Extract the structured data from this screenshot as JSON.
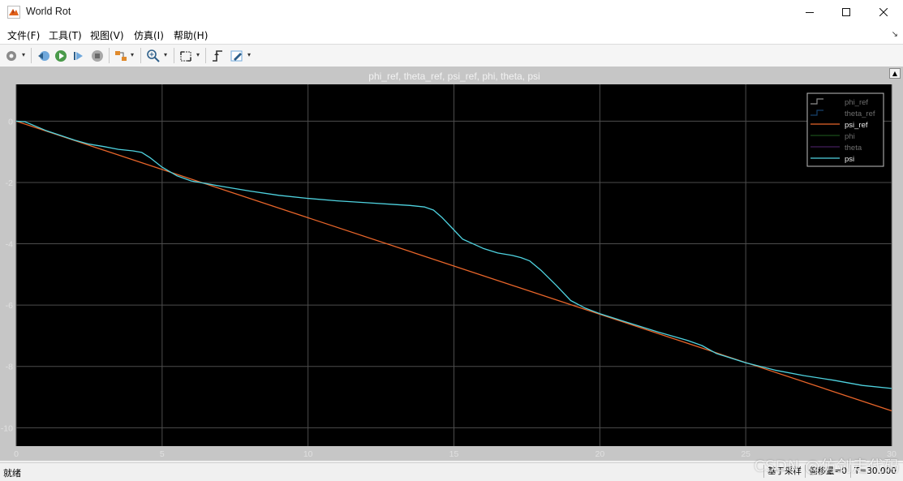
{
  "window": {
    "title": "World Rot",
    "icon": "matlab-logo-icon",
    "controls": [
      "minimize-icon",
      "maximize-icon",
      "close-icon"
    ]
  },
  "menu": {
    "items": [
      {
        "label": "文件(F)"
      },
      {
        "label": "工具(T)"
      },
      {
        "label": "视图(V)"
      },
      {
        "label": "仿真(I)"
      },
      {
        "label": "帮助(H)"
      }
    ]
  },
  "toolbar": {
    "buttons": [
      "settings-gear-icon",
      "step-back-icon",
      "run-icon",
      "step-forward-icon",
      "stop-icon",
      "highlight-simulink-block-icon",
      "zoom-in-icon",
      "fit-axes-icon",
      "trigger-icon",
      "style-pen-icon"
    ]
  },
  "colors": {
    "plot_bg": "#000000",
    "frame_bg": "#c6c6c6",
    "grid": "#4d4d4d",
    "axis_text": "#e0e0e0",
    "psi_ref": "#e8652a",
    "psi": "#4fd3e0",
    "phi_ref": "#ffffff",
    "theta_ref": "#2979c8",
    "phi": "#2e8b2e",
    "theta": "#7a3aa8"
  },
  "chart_data": {
    "type": "line",
    "title": "phi_ref, theta_ref, psi_ref, phi, theta, psi",
    "xlabel": "",
    "ylabel": "",
    "xlim": [
      0,
      30
    ],
    "ylim": [
      -10.6,
      1.2
    ],
    "xticks": [
      0,
      5,
      10,
      15,
      20,
      25,
      30
    ],
    "yticks": [
      0,
      -2,
      -4,
      -6,
      -8,
      -10
    ],
    "grid": true,
    "legend_position": "top-right",
    "series": [
      {
        "name": "phi_ref",
        "color": "#ffffff",
        "dim": true,
        "x": [],
        "y": []
      },
      {
        "name": "theta_ref",
        "color": "#2979c8",
        "dim": true,
        "x": [],
        "y": []
      },
      {
        "name": "psi_ref",
        "color": "#e8652a",
        "x": [
          0,
          30
        ],
        "y": [
          0,
          -9.45
        ]
      },
      {
        "name": "phi",
        "color": "#2e8b2e",
        "dim": true,
        "x": [],
        "y": []
      },
      {
        "name": "theta",
        "color": "#7a3aa8",
        "dim": true,
        "x": [],
        "y": []
      },
      {
        "name": "psi",
        "color": "#4fd3e0",
        "x": [
          0,
          0.3,
          1,
          2,
          2.5,
          3,
          3.5,
          4,
          4.3,
          4.6,
          5,
          5.5,
          6,
          7,
          8,
          9,
          10,
          11,
          12,
          13,
          13.5,
          14,
          14.3,
          14.6,
          15,
          15.3,
          15.7,
          16,
          16.5,
          17,
          17.3,
          17.6,
          18,
          18.5,
          19,
          19.5,
          20,
          21,
          22,
          23,
          23.5,
          24,
          25,
          26,
          27,
          28,
          29,
          30
        ],
        "y": [
          0,
          -0.02,
          -0.3,
          -0.62,
          -0.75,
          -0.83,
          -0.92,
          -0.97,
          -1.02,
          -1.2,
          -1.5,
          -1.78,
          -1.95,
          -2.12,
          -2.28,
          -2.42,
          -2.52,
          -2.6,
          -2.66,
          -2.72,
          -2.75,
          -2.8,
          -2.9,
          -3.15,
          -3.55,
          -3.85,
          -4.02,
          -4.15,
          -4.3,
          -4.38,
          -4.45,
          -4.56,
          -4.88,
          -5.35,
          -5.85,
          -6.1,
          -6.28,
          -6.58,
          -6.88,
          -7.15,
          -7.32,
          -7.58,
          -7.88,
          -8.12,
          -8.3,
          -8.45,
          -8.62,
          -8.72
        ]
      }
    ]
  },
  "status": {
    "left": "就绪",
    "sample_mode": "基于采样",
    "offset": "偏移量=0",
    "time": "T=30.000"
  },
  "watermark": "CSDN @仿剑走代码"
}
